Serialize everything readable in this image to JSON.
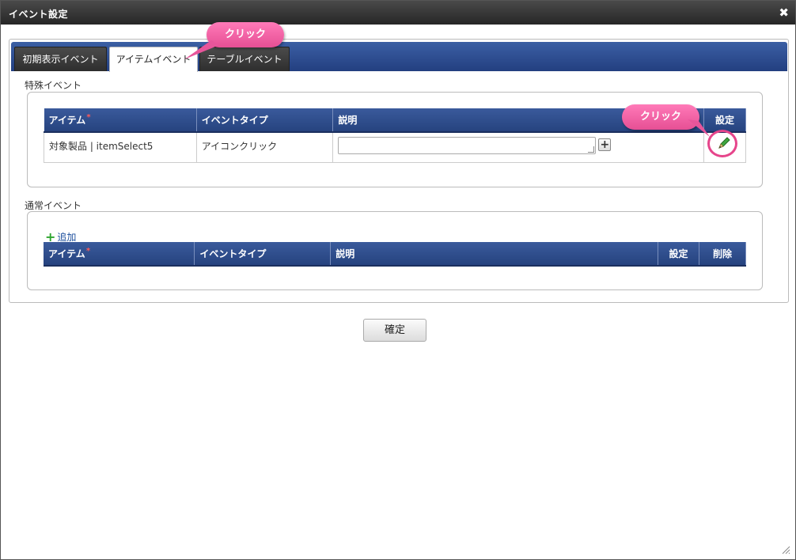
{
  "window": {
    "title": "イベント設定",
    "close_glyph": "✖"
  },
  "tabs": [
    {
      "label": "初期表示イベント",
      "active": false
    },
    {
      "label": "アイテムイベント",
      "active": true
    },
    {
      "label": "テーブルイベント",
      "active": false
    }
  ],
  "special_events": {
    "section_label": "特殊イベント",
    "columns": [
      "アイテム",
      "イベントタイプ",
      "説明",
      "設定"
    ],
    "rows": [
      {
        "item": "対象製品 | itemSelect5",
        "event_type": "アイコンクリック",
        "description": ""
      }
    ]
  },
  "normal_events": {
    "section_label": "通常イベント",
    "add_label": "追加",
    "columns": [
      "アイテム",
      "イベントタイプ",
      "説明",
      "設定",
      "削除"
    ]
  },
  "required_mark": "*",
  "confirm_label": "確定",
  "annotations": {
    "tab_callout": "クリック",
    "settings_callout": "クリック"
  },
  "colors": {
    "tab_bar": "#2a4687",
    "header": "#2f4f8f",
    "callout": "#f064a8",
    "required": "#ff5a5a",
    "add_icon": "#2fa52f"
  },
  "icons": [
    "close-icon",
    "pencil-icon",
    "plus-icon",
    "add-icon",
    "resize-grip-icon"
  ]
}
